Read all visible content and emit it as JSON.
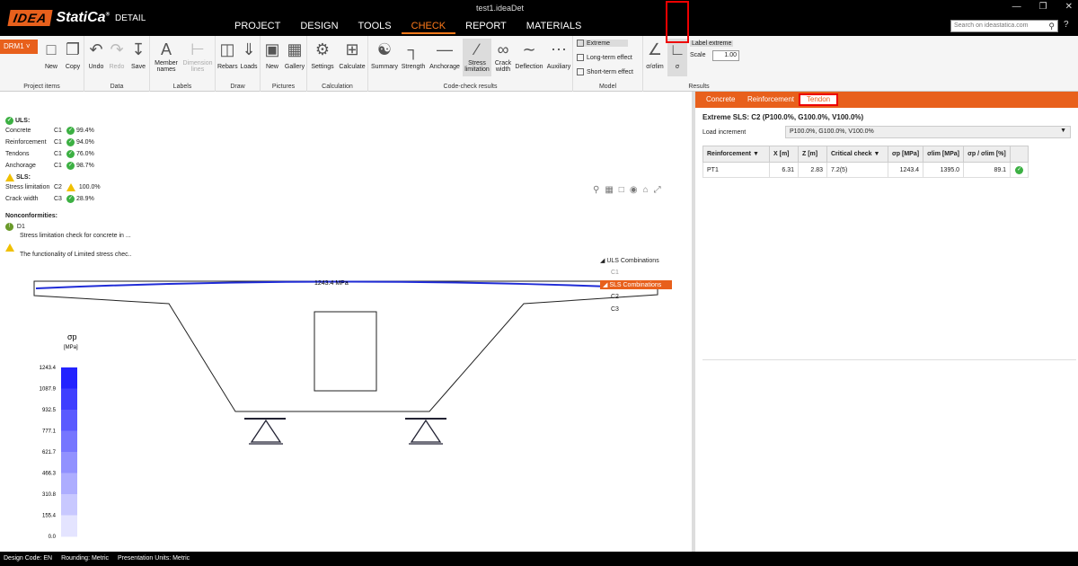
{
  "app": {
    "filename": "test1.ideaDet",
    "logo_idea": "IDEA",
    "logo_statica": "StatiCa",
    "logo_reg": "®",
    "logo_detail": "DETAIL",
    "search_placeholder": "Search on ideastatica.com",
    "menu": [
      "PROJECT",
      "DESIGN",
      "TOOLS",
      "CHECK",
      "REPORT",
      "MATERIALS"
    ],
    "active_menu": "CHECK"
  },
  "ribbon": {
    "project_selector": "DRM1",
    "groups": {
      "project_items": "Project items",
      "data": "Data",
      "labels": "Labels",
      "draw": "Draw",
      "pictures": "Pictures",
      "calculation": "Calculation",
      "code_check_results": "Code-check results",
      "model": "Model",
      "results": "Results"
    },
    "buttons": {
      "new": "New",
      "copy": "Copy",
      "undo": "Undo",
      "redo": "Redo",
      "save": "Save",
      "member_names": "Member names",
      "dimension_lines": "Dimension lines",
      "rebars": "Rebars",
      "loads": "Loads",
      "pic_new": "New",
      "gallery": "Gallery",
      "settings": "Settings",
      "calculate": "Calculate",
      "summary": "Summary",
      "strength": "Strength",
      "anchorage": "Anchorage",
      "stress_limitation": "Stress limitation",
      "crack_width": "Crack width",
      "deflection": "Deflection",
      "auxiliary": "Auxiliary",
      "sigma_lim": "σ/σlim",
      "sigma": "σ"
    },
    "model_options": [
      "Extreme",
      "Long-term effect",
      "Short-term effect"
    ],
    "label_extreme": "Label extreme",
    "scale_label": "Scale",
    "scale_value": "1.00"
  },
  "summary": {
    "uls_title": "ULS:",
    "uls_rows": [
      {
        "label": "Concrete",
        "combo": "C1",
        "value": "99.4%"
      },
      {
        "label": "Reinforcement",
        "combo": "C1",
        "value": "94.0%"
      },
      {
        "label": "Tendons",
        "combo": "C1",
        "value": "76.0%"
      },
      {
        "label": "Anchorage",
        "combo": "C1",
        "value": "98.7%"
      }
    ],
    "sls_title": "SLS:",
    "sls_rows": [
      {
        "label": "Stress limitation",
        "combo": "C2",
        "value": "100.0%"
      },
      {
        "label": "Crack width",
        "combo": "C3",
        "value": "28.9%"
      }
    ],
    "nonconf_title": "Nonconformities:",
    "nonconf": [
      {
        "id": "D1",
        "text": "Stress limitation check for concrete in ..."
      },
      {
        "id": "",
        "text": "The functionality of Limited stress chec.."
      }
    ]
  },
  "combos": {
    "uls_header": "ULS Combinations",
    "uls_items": [
      "C1"
    ],
    "sls_header": "SLS Combinations",
    "sls_items": [
      "C2",
      "C3"
    ]
  },
  "drawing": {
    "tendon_label": "1243.4 MPa",
    "legend_title": "σp",
    "legend_unit": "[MPa]",
    "legend_values": [
      "1243.4",
      "1087.9",
      "932.5",
      "777.1",
      "621.7",
      "466.3",
      "310.8",
      "155.4",
      "0.0"
    ],
    "tendon_color": "#1f2bd6"
  },
  "right": {
    "tabs": [
      "Concrete",
      "Reinforcement",
      "Tendon"
    ],
    "active_tab": "Tendon",
    "extreme_title": "Extreme SLS: C2 (P100.0%, G100.0%, V100.0%)",
    "load_increment_label": "Load increment",
    "load_increment_value": "P100.0%, G100.0%, V100.0%",
    "table": {
      "headers": [
        "Reinforcement",
        "X [m]",
        "Z [m]",
        "Critical check",
        "σp [MPa]",
        "σlim [MPa]",
        "σp / σlim [%]",
        ""
      ],
      "rows": [
        {
          "reinforcement": "PT1",
          "x": "6.31",
          "z": "2.83",
          "critical": "7.2(5)",
          "sp": "1243.4",
          "slim": "1395.0",
          "ratio": "89.1"
        }
      ]
    }
  },
  "status": {
    "items": [
      "Design Code: EN",
      "Rounding: Metric",
      "Presentation Units: Metric"
    ]
  },
  "colors": {
    "accent": "#e8601c",
    "ok": "#3cb043",
    "warn": "#f0c000"
  }
}
